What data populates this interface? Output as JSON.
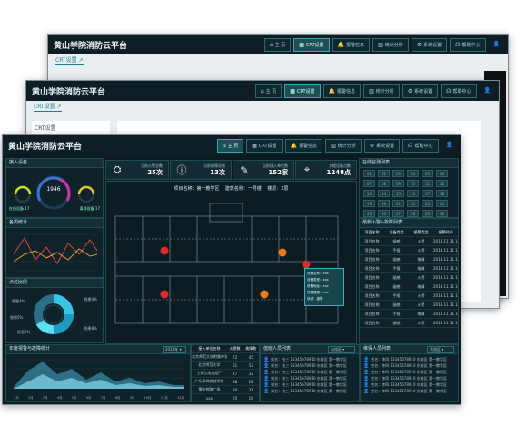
{
  "app": {
    "title": "黄山学院消防云平台"
  },
  "nav": [
    {
      "icon": "home-icon",
      "glyph": "⌂",
      "label": "主 页"
    },
    {
      "icon": "grid-icon",
      "glyph": "▦",
      "label": "CRT设置"
    },
    {
      "icon": "bell-icon",
      "glyph": "🔔",
      "label": "报警信息"
    },
    {
      "icon": "bar-chart-icon",
      "glyph": "▥",
      "label": "统计分析"
    },
    {
      "icon": "gear-icon",
      "glyph": "⚙",
      "label": "系统设置"
    },
    {
      "icon": "help-icon",
      "glyph": "☊",
      "label": "帮助中心"
    }
  ],
  "back_window": {
    "tab": "CRT设置 ↗"
  },
  "middle_window": {
    "tab": "CRT设置 ↗",
    "sub_label": "CRT设置"
  },
  "front": {
    "access_panel": {
      "title": "接入设备",
      "gauge_value": "1946",
      "left_label": "在线设备",
      "left_value": "17",
      "right_label": "离线设备",
      "right_value": "17"
    },
    "trend_panel": {
      "title": "各周统计"
    },
    "pie_panel": {
      "title": "点位比例",
      "labels": [
        "隐患4%",
        "隐患5%",
        "隐患6%",
        "隐患4%",
        "隐患8%"
      ]
    },
    "stats": [
      {
        "icon": "alarm-light-icon",
        "glyph": "⛭",
        "label": "当前火警总数",
        "value": "25次"
      },
      {
        "icon": "alert-circle-icon",
        "glyph": "ⓘ",
        "label": "当前故障总数",
        "value": "13次"
      },
      {
        "icon": "edit-icon",
        "glyph": "✎",
        "label": "当前接入单位数",
        "value": "152家"
      },
      {
        "icon": "pin-icon",
        "glyph": "⌖",
        "label": "大楼设备点数",
        "value": "1248点"
      }
    ],
    "floor": {
      "caption": "项目名称：第一教学区    建筑名称：一号楼    楼层：1层",
      "popup": [
        "设备名称：xxx",
        "设备类型：xxx",
        "设备地址：xxx",
        "所属楼层：xxx",
        "状态：报警"
      ]
    },
    "right_grid": {
      "title": "在线监测列表",
      "cells": [
        "01",
        "02",
        "03",
        "04",
        "05",
        "06",
        "07",
        "08",
        "09",
        "10",
        "11",
        "12",
        "13",
        "14",
        "15",
        "16",
        "17",
        "18",
        "19",
        "20",
        "21",
        "22",
        "23",
        "24",
        "25",
        "26",
        "27",
        "28",
        "29",
        "30"
      ]
    },
    "alarm_list": {
      "title": "最新火警&故障列表",
      "headers": [
        "项目名称",
        "设备类型",
        "报警类型",
        "报警时间"
      ],
      "rows": [
        [
          "项目名称",
          "烟感",
          "火警",
          "2018.11.11 16:00"
        ],
        [
          "项目名称",
          "手报",
          "火警",
          "2018.11.11 16:00"
        ],
        [
          "项目名称",
          "烟感",
          "故障",
          "2018.11.11 16:00"
        ],
        [
          "项目名称",
          "手报",
          "故障",
          "2018.11.11 16:00"
        ],
        [
          "项目名称",
          "烟感",
          "火警",
          "2018.11.11 16:00"
        ],
        [
          "项目名称",
          "烟感",
          "故障",
          "2018.11.11 16:00"
        ],
        [
          "项目名称",
          "手报",
          "火警",
          "2018.11.11 16:00"
        ],
        [
          "项目名称",
          "烟感",
          "火警",
          "2018.11.11 16:00"
        ],
        [
          "项目名称",
          "手报",
          "故障",
          "2018.11.11 16:00"
        ],
        [
          "项目名称",
          "烟感",
          "火警",
          "2018.11.11 16:00"
        ]
      ]
    },
    "area_panel": {
      "title": "年度报警与故障统计",
      "select": "2018年",
      "x_labels": [
        "1月",
        "2月",
        "3月",
        "4月",
        "5月",
        "6月",
        "7月",
        "8月",
        "9月",
        "10月",
        "11月",
        "12月"
      ]
    },
    "unit_table": {
      "headers": [
        "接入单位名称",
        "火警数",
        "故障数"
      ],
      "rows": [
        [
          "北京师范大学附属中学",
          "72",
          "45"
        ],
        [
          "北京师范大学",
          "61",
          "53"
        ],
        [
          "上海江南造船厂",
          "47",
          "32"
        ],
        [
          "广东深圳实验学校",
          "38",
          "28"
        ],
        [
          "重庆铁路广场",
          "30",
          "31"
        ],
        [
          "xxx",
          "25",
          "19"
        ],
        [
          "xxx",
          "20",
          "17"
        ]
      ]
    },
    "person_panels": [
      {
        "title": "值班人员列表",
        "select": "东校区",
        "row": "姓名：张三  13345678910  东校区  第一教学区"
      },
      {
        "title": "维保人员列表",
        "select": "东校区",
        "row": "姓名：李四  13345678910  东校区  第一教学区"
      }
    ]
  }
}
